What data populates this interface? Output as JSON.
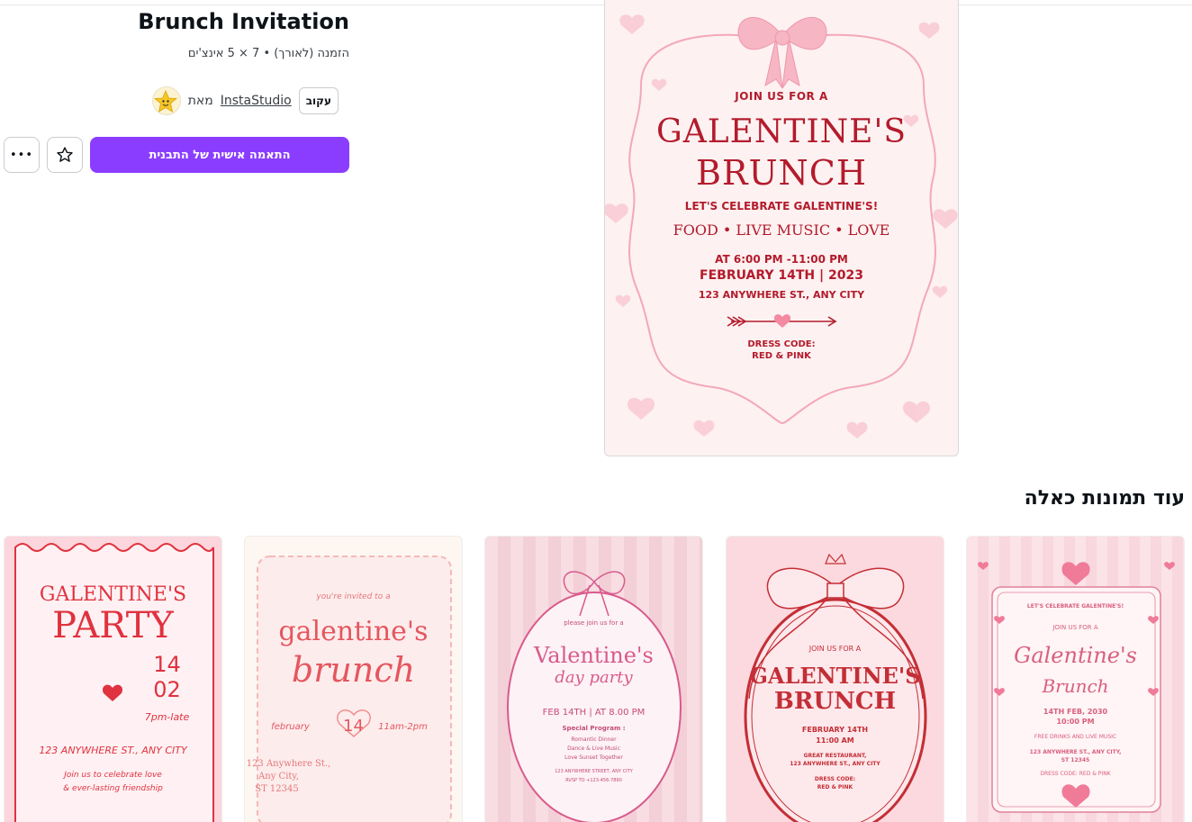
{
  "header": {
    "title": "Brunch Invitation",
    "subtitle": "הזמנה (לאורך) • 7 × 5 אינצ'ים",
    "by_label": "מאת",
    "author": "InstaStudio",
    "follow_label": "עקוב"
  },
  "actions": {
    "customize_label": "התאמה אישית של התבנית",
    "more_label": "•••",
    "favorite_icon": "star-icon"
  },
  "preview": {
    "line1": "JOIN US FOR A",
    "line2": "GALENTINE'S",
    "line3": "BRUNCH",
    "line4": "LET'S CELEBRATE GALENTINE'S!",
    "line5": "FOOD • LIVE MUSIC • LOVE",
    "line6": "AT 6:00 PM -11:00 PM",
    "line7": "FEBRUARY 14TH | 2023",
    "line8": "123 ANYWHERE ST., ANY CITY",
    "line9": "DRESS CODE:",
    "line10": "RED & PINK"
  },
  "similar": {
    "title": "עוד תמונות כאלה",
    "cards": [
      {
        "l1": "GALENTINE'S",
        "l2": "PARTY",
        "l3": "14",
        "l4": "02",
        "l5": "7pm-late",
        "l6": "123 ANYWHERE ST., ANY CITY",
        "l7": "Join us to celebrate love",
        "l8": "& ever-lasting friendship"
      },
      {
        "l1": "you're invited to a",
        "l2": "galentine's",
        "l3": "brunch",
        "l4": "february",
        "l5": "14",
        "l6": "11am-2pm",
        "l7": "123 Anywhere St.,",
        "l8": "Any City,",
        "l9": "ST 12345"
      },
      {
        "l1": "please join us for a",
        "l2": "Valentine's",
        "l3": "day party",
        "l4": "FEB 14TH | AT 8.00 PM",
        "l5": "Special Program :",
        "l6": "Romantic Dinner",
        "l7": "Dance & Live Music",
        "l8": "Love Sunset Together",
        "l9": "123 ANYWHERE STREET, ANY CITY",
        "l10": "RVSP TO +123-456-7890"
      },
      {
        "l1": "JOIN US FOR A",
        "l2": "GALENTINE'S",
        "l3": "BRUNCH",
        "l4": "FEBRUARY 14TH",
        "l5": "11:00 AM",
        "l6": "GREAT RESTAURANT,",
        "l7": "123 ANYWHERE ST., ANY CITY",
        "l8": "DRESS CODE:",
        "l9": "RED & PINK"
      },
      {
        "l1": "LET'S CELEBRATE GALENTINE'S!",
        "l2": "JOIN US FOR A",
        "l3": "Galentine's",
        "l4": "Brunch",
        "l5": "14TH FEB, 2030",
        "l6": "10:00 PM",
        "l7": "FREE DRINKS AND LIVE MUSIC",
        "l8": "123 ANYWHERE ST., ANY CITY,",
        "l9": "ST 12345",
        "l10": "DRESS CODE: RED & PINK"
      }
    ]
  },
  "colors": {
    "accent": "#8b3dff",
    "preview_bg": "#fdf1f1",
    "preview_text": "#b31b2c"
  }
}
